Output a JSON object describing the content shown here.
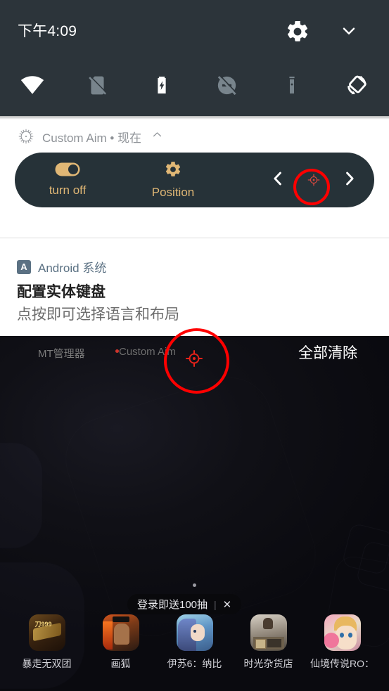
{
  "status_bar": {
    "clock": "下午4:09",
    "settings_icon": "gear-icon",
    "expand_icon": "chevron-down-icon"
  },
  "quick_settings": {
    "tiles": [
      {
        "name": "wifi",
        "icon": "wifi-icon",
        "state": "on"
      },
      {
        "name": "mobile-data",
        "icon": "sim-off-icon",
        "state": "off"
      },
      {
        "name": "battery-saver",
        "icon": "battery-charging-icon",
        "state": "on"
      },
      {
        "name": "do-not-disturb",
        "icon": "dnd-off-icon",
        "state": "off"
      },
      {
        "name": "flashlight",
        "icon": "flashlight-icon",
        "state": "off"
      },
      {
        "name": "auto-rotate",
        "icon": "auto-rotate-icon",
        "state": "on"
      }
    ]
  },
  "notifications": [
    {
      "app_name": "Custom Aim",
      "time": "现在",
      "separator": "•",
      "app_icon": "crosshair-burst-icon",
      "collapse_icon": "chevron-up-icon",
      "actions": [
        {
          "label": "turn off",
          "icon": "toggle-on-icon"
        },
        {
          "label": "Position",
          "icon": "gear-icon"
        }
      ],
      "nav": {
        "prev_icon": "chevron-left-icon",
        "crosshair_icon": "crosshair-icon",
        "next_icon": "chevron-right-icon"
      }
    },
    {
      "app_name": "Android 系统",
      "app_icon": "android-system-icon",
      "app_icon_letter": "A",
      "title": "配置实体键盘",
      "body": "点按即可选择语言和布局"
    }
  ],
  "ongoing": {
    "items": [
      {
        "label": "MT管理器",
        "has_dot": false
      },
      {
        "label": "Custom Aim",
        "has_dot": true
      }
    ],
    "clear_all_label": "全部清除"
  },
  "annotations": {
    "highlight_1": "red-circle-on-crosshair-button",
    "highlight_2": "red-circle-on-floating-crosshair"
  },
  "home": {
    "page_indicator_dots": 1,
    "promo": {
      "text": "登录即送100抽",
      "separator": "|",
      "close_icon": "close-icon"
    },
    "dock_apps": [
      {
        "label": "暴走无双团",
        "icon": "game-icon-blade"
      },
      {
        "label": "画狐",
        "icon": "game-icon-fox"
      },
      {
        "label": "伊苏6：纳比",
        "icon": "game-icon-ys6"
      },
      {
        "label": "时光杂货店",
        "icon": "game-icon-store"
      },
      {
        "label": "仙境传说RO：",
        "icon": "game-icon-ro"
      }
    ]
  },
  "colors": {
    "qs_panel_bg": "#2c343a",
    "shade_bg": "#ffffff",
    "card_bg": "#263238",
    "accent_amber": "#e0b775",
    "annotation_red": "#ff0000",
    "android_blue_grey": "#5b7183",
    "wallpaper_dark": "#0b0b10"
  }
}
